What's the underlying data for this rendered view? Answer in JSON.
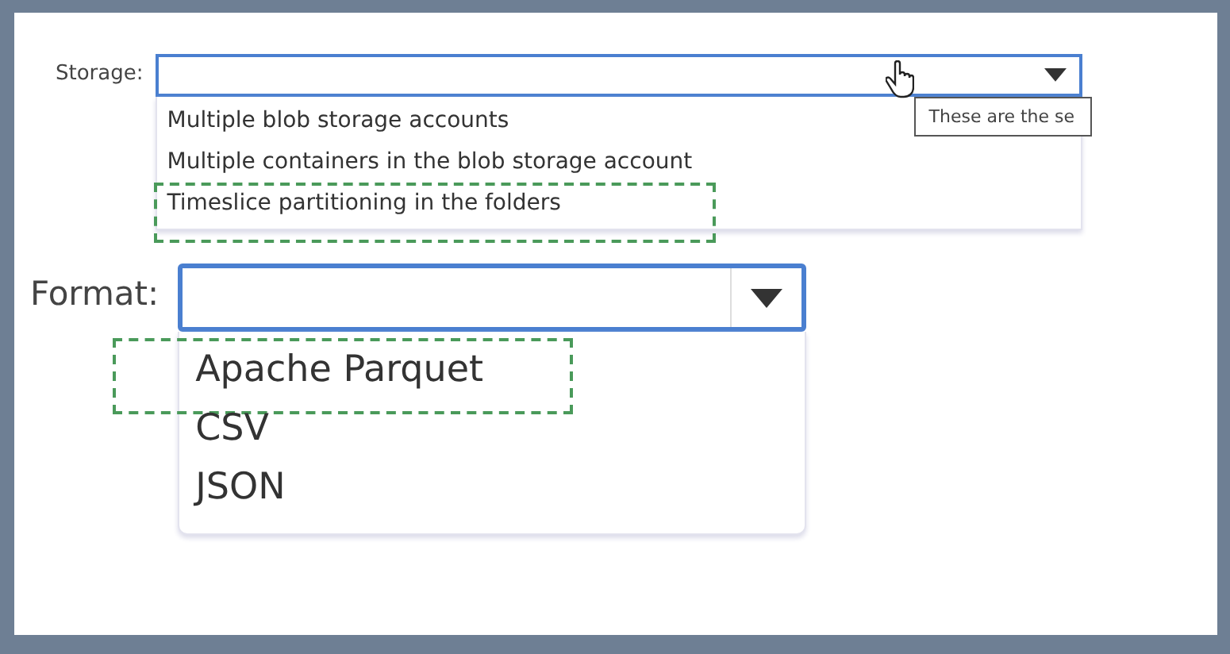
{
  "storage": {
    "label": "Storage:",
    "tooltip": "These are the se",
    "options": [
      {
        "label": "Multiple blob storage accounts",
        "selected": false
      },
      {
        "label": "Multiple containers in the blob storage account",
        "selected": false
      },
      {
        "label": "Timeslice partitioning in the folders",
        "selected": true
      }
    ]
  },
  "format": {
    "label": "Format:",
    "options": [
      {
        "label": "Apache Parquet",
        "selected": true
      },
      {
        "label": "CSV",
        "selected": false
      },
      {
        "label": "JSON",
        "selected": false
      }
    ]
  }
}
